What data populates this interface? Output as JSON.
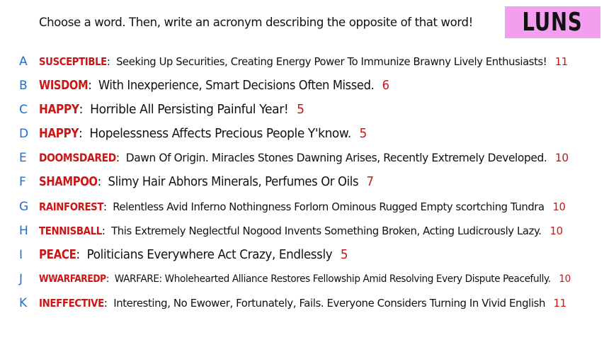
{
  "header": {
    "prompt": "Choose a word. Then, write an acronym describing the opposite of that word!",
    "brand": "LUNS"
  },
  "colors": {
    "letter": "#1f6fd6",
    "word": "#cc1616",
    "score": "#cc1616",
    "brand_bg": "#f49ef0"
  },
  "entries": [
    {
      "letter": "A",
      "word": "SUSCEPTIBLE",
      "acronym": "Seeking Up Securities, Creating Energy Power To Immunize Brawny Lively Enthusiasts!",
      "score": "11"
    },
    {
      "letter": "B",
      "word": "WISDOM",
      "acronym": "With Inexperience, Smart Decisions Often Missed.",
      "score": "6"
    },
    {
      "letter": "C",
      "word": "HAPPY",
      "acronym": "Horrible All Persisting Painful Year!",
      "score": "5"
    },
    {
      "letter": "D",
      "word": "HAPPY",
      "acronym": "Hopelessness Affects Precious People Y'know.",
      "score": "5"
    },
    {
      "letter": "E",
      "word": "DOOMSDARED",
      "acronym": "Dawn Of Origin. Miracles Stones Dawning Arises, Recently Extremely Developed.",
      "score": "10"
    },
    {
      "letter": "F",
      "word": "SHAMPOO",
      "acronym": "Slimy Hair Abhors Minerals, Perfumes Or Oils",
      "score": "7"
    },
    {
      "letter": "G",
      "word": "RAINFOREST",
      "acronym": "Relentless Avid Inferno Nothingness Forlorn Ominous Rugged Empty scortching Tundra",
      "score": "10"
    },
    {
      "letter": "H",
      "word": "TENNISBALL",
      "acronym": "This Extremely Neglectful Nogood Invents Something Broken, Acting Ludicrously Lazy.",
      "score": "10"
    },
    {
      "letter": "I",
      "word": "PEACE",
      "acronym": "Politicians Everywhere Act Crazy, Endlessly",
      "score": "5"
    },
    {
      "letter": "J",
      "word": "WWARFAREDP",
      "acronym": "WARFARE: Wholehearted Alliance Restores Fellowship Amid Resolving Every Dispute Peacefully.",
      "score": "10"
    },
    {
      "letter": "K",
      "word": "INEFFECTIVE",
      "acronym": "Interesting, No Ewower, Fortunately, Fails. Everyone Considers Turning In Vivid English",
      "score": "11"
    }
  ]
}
